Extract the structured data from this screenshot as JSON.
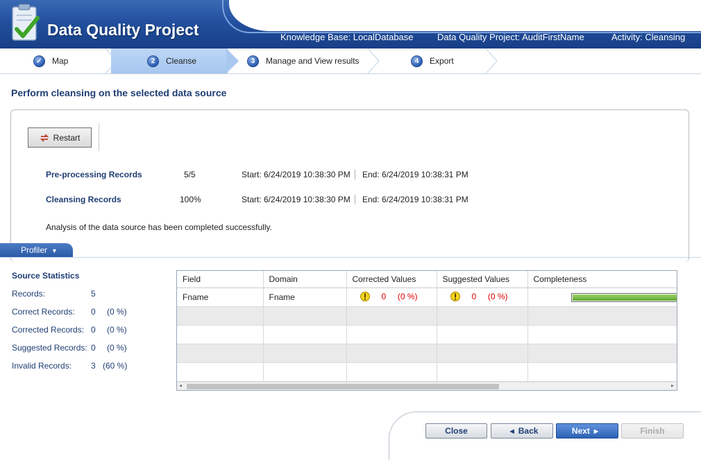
{
  "header": {
    "app_title": "Data Quality Project",
    "knowledge_base": "Knowledge Base: LocalDatabase",
    "project": "Data Quality Project: AuditFirstName",
    "activity": "Activity: Cleansing"
  },
  "steps": [
    {
      "num": "1",
      "label": "Map"
    },
    {
      "num": "2",
      "label": "Cleanse"
    },
    {
      "num": "3",
      "label": "Manage and View results"
    },
    {
      "num": "4",
      "label": "Export"
    }
  ],
  "page_title": "Perform cleansing on the selected data source",
  "restart_label": "Restart",
  "progress": [
    {
      "label": "Pre-processing Records",
      "value": "5/5",
      "start": "Start: 6/24/2019 10:38:30 PM",
      "end": "End: 6/24/2019 10:38:31 PM"
    },
    {
      "label": "Cleansing Records",
      "value": "100%",
      "start": "Start: 6/24/2019 10:38:30 PM",
      "end": "End: 6/24/2019 10:38:31 PM"
    }
  ],
  "analysis_message": "Analysis of the data source has been completed successfully.",
  "profiler": {
    "tab_label": "Profiler",
    "stats_title": "Source Statistics",
    "stats": [
      {
        "label": "Records:",
        "count": "5",
        "pct": ""
      },
      {
        "label": "Correct Records:",
        "count": "0",
        "pct": "(0 %)"
      },
      {
        "label": "Corrected Records:",
        "count": "0",
        "pct": "(0 %)"
      },
      {
        "label": "Suggested Records:",
        "count": "0",
        "pct": "(0 %)"
      },
      {
        "label": "Invalid Records:",
        "count": "3",
        "pct": "(60 %)"
      }
    ],
    "grid": {
      "columns": [
        "Field",
        "Domain",
        "Corrected Values",
        "Suggested Values",
        "Completeness"
      ],
      "row": {
        "field": "Fname",
        "domain": "Fname",
        "corrected_count": "0",
        "corrected_pct": "(0 %)",
        "suggested_count": "0",
        "suggested_pct": "(0 %)",
        "completeness_fraction": 1.0
      }
    }
  },
  "footer": {
    "close": "Close",
    "back": "Back",
    "next": "Next",
    "finish": "Finish"
  },
  "colors": {
    "accent": "#2c62b5",
    "title": "#1f3d73",
    "error": "#dd0000",
    "completeness": "#62a532"
  }
}
